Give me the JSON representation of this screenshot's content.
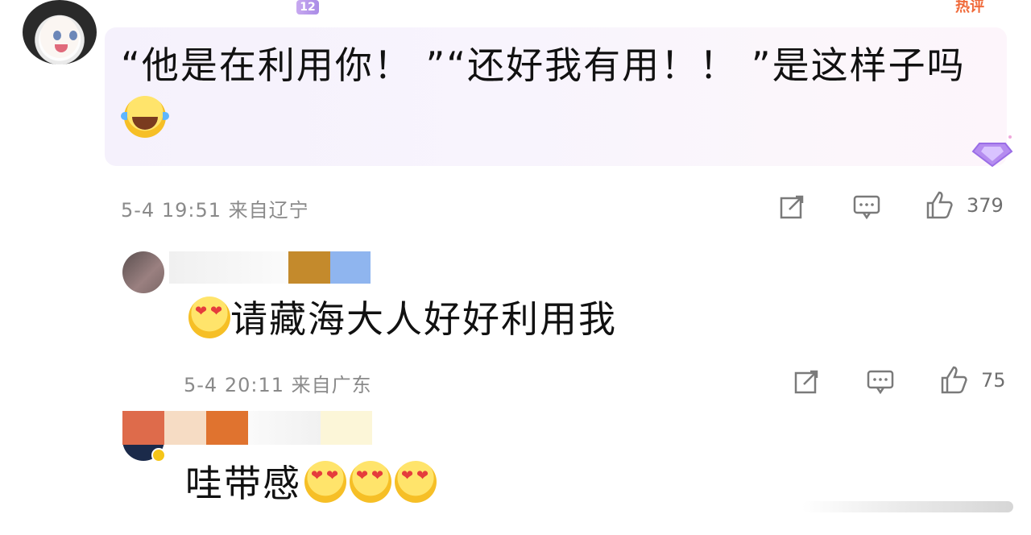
{
  "comments": [
    {
      "badge": "12",
      "hot_label": "热评",
      "text": "“他是在利用你！ ”“还好我有用！！ ”是这样子吗",
      "emoji": "laughing-tears-emoji",
      "meta": "5-4 19:51 来自辽宁",
      "likes": "379",
      "actions": [
        "share-icon",
        "comment-icon",
        "like-icon"
      ]
    },
    {
      "text": "请藏海大人好好利用我",
      "emoji": "heart-eyes-emoji",
      "meta": "5-4 20:11 来自广东",
      "likes": "75",
      "actions": [
        "share-icon",
        "comment-icon",
        "like-icon"
      ]
    },
    {
      "text": "哇带感",
      "emojis": [
        "drooling-heart-eyes-emoji",
        "drooling-heart-eyes-emoji",
        "drooling-heart-eyes-emoji"
      ]
    }
  ],
  "colors": {
    "bubble_start": "#f5f1fc",
    "bubble_end": "#fdf5fb",
    "meta_text": "#8a8a8a",
    "hot_tag": "#f06a3a",
    "badge": "#b89cf0"
  }
}
